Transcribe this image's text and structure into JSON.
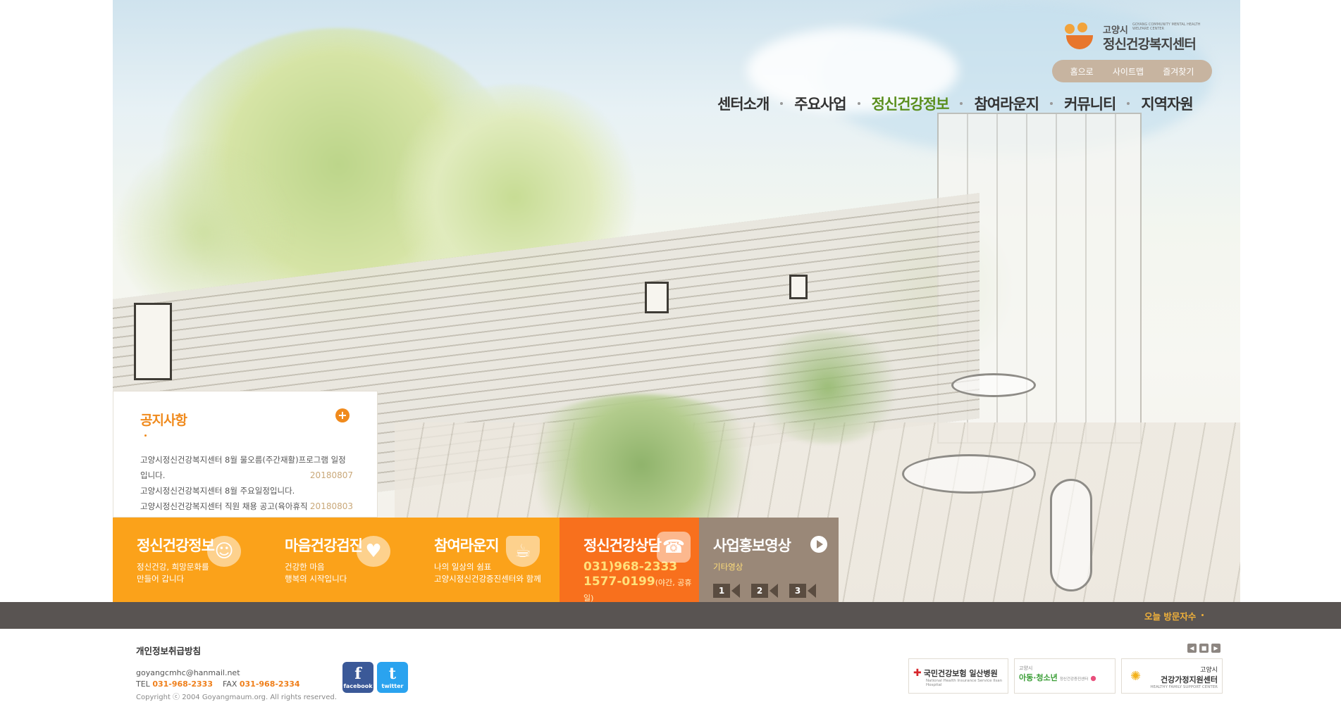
{
  "logo": {
    "city": "고양시",
    "english": "GOYANG COMMUNITY MENTAL HEALTH WELFARE CENTER",
    "name": "정신건강복지센터"
  },
  "util_menu": [
    "홈으로",
    "사이트맵",
    "즐겨찾기"
  ],
  "gnb": {
    "active": "정신건강정보",
    "items": [
      "센터소개",
      "주요사업",
      "정신건강정보",
      "참여라운지",
      "커뮤니티",
      "지역자원"
    ]
  },
  "notice": {
    "title": "공지사항",
    "more_icon": "plus-icon",
    "items": [
      {
        "title": "고양시정신건강복지센터 8월 물오름(주간재활)프로그램 일정입니다.",
        "date": "20180807"
      },
      {
        "title": "고양시정신건강복지센터 8월 주요일정입니다.",
        "date": "20180807"
      },
      {
        "title": "고양시정신건강복지센터 직원 채용 공고(육아휴직 대체인력)",
        "date": "20180803"
      }
    ]
  },
  "quick": {
    "info": {
      "title": "정신건강정보",
      "desc1": "정신건강, 희망문화를",
      "desc2": "만들어 갑니다",
      "icon": "smile-icon"
    },
    "checkup": {
      "title": "마음건강검진",
      "desc1": "건강한 마음",
      "desc2": "행복의 시작입니다",
      "icon": "heart-search-icon"
    },
    "lounge": {
      "title": "참여라운지",
      "desc1": "나의 일상의 쉼표",
      "desc2": "고양시정신건강증진센터와 함께",
      "icon": "cup-icon"
    },
    "counsel": {
      "title": "정신건강상담",
      "phone1": "031)968-2333",
      "phone2": "1577-0199",
      "phone2_note": "(야간, 공휴일)",
      "icon": "phone-icon"
    },
    "video": {
      "title": "사업홍보영상",
      "sub": "기타영상",
      "buttons": [
        "1",
        "2",
        "3"
      ],
      "icon": "play-icon"
    }
  },
  "visitors": {
    "label": "오늘 방문자수"
  },
  "footer": {
    "privacy": "개인정보취급방침",
    "email": "goyangcmhc@hanmail.net",
    "tel_label": "TEL",
    "tel": "031-968-2333",
    "fax_label": "FAX",
    "fax": "031-968-2334",
    "copyright": "Copyright ⓒ 2004 Goyangmaum.org. All rights reserved.",
    "sns": [
      {
        "name": "facebook",
        "glyph": "f"
      },
      {
        "name": "twitter",
        "glyph": "t"
      }
    ],
    "banners": [
      {
        "main": "국민건강보험 일산병원",
        "small": "National Health Insurance Service Ilsan Hospital"
      },
      {
        "top": "고양시",
        "main": "아동·청소년",
        "small": "정신건강증진센터"
      },
      {
        "top": "고양시",
        "main": "건강가정지원센터",
        "small": "HEALTHY FAMILY SUPPORT CENTER"
      }
    ]
  },
  "colors": {
    "orange": "#fba21a",
    "orange_dark": "#f8701d",
    "taupe": "#9a8878",
    "gray_bar": "#595452",
    "nav_active": "#5b8f1e"
  }
}
